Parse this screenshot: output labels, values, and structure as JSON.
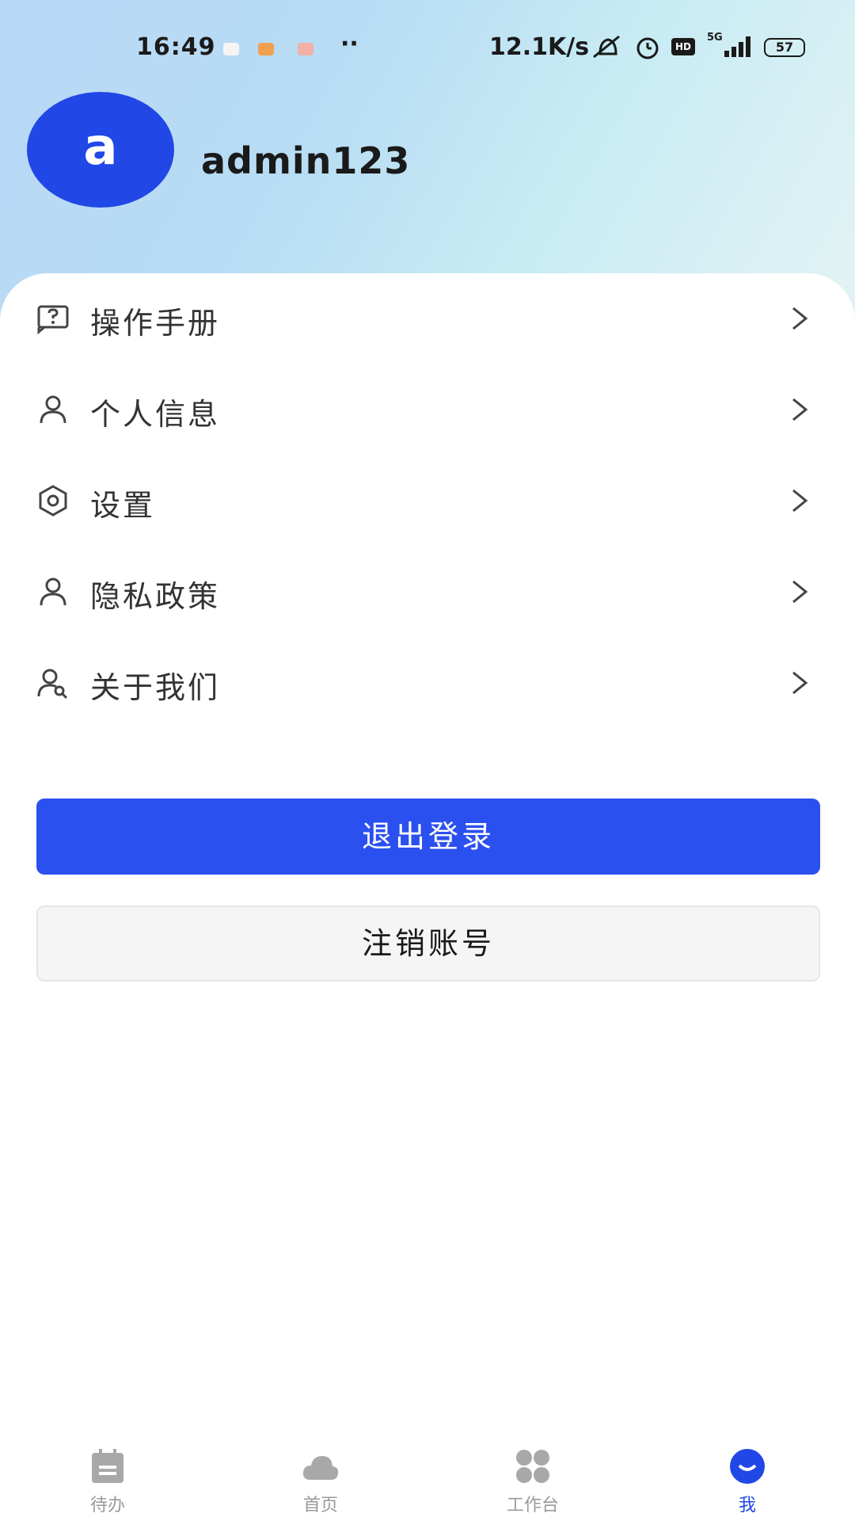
{
  "status_bar": {
    "time": "16:49",
    "dots": "··",
    "network_speed": "12.1K/s",
    "hd_label": "HD",
    "network_type": "5G",
    "battery": "57"
  },
  "profile": {
    "avatar_letter": "a",
    "username": "admin123"
  },
  "menu": {
    "items": [
      {
        "label": "操作手册",
        "icon": "question-book-icon"
      },
      {
        "label": "个人信息",
        "icon": "person-icon"
      },
      {
        "label": "设置",
        "icon": "hexagon-gear-icon"
      },
      {
        "label": "隐私政策",
        "icon": "person-icon"
      },
      {
        "label": "关于我们",
        "icon": "person-search-icon"
      }
    ]
  },
  "actions": {
    "logout_label": "退出登录",
    "deactivate_label": "注销账号"
  },
  "tab_bar": {
    "items": [
      {
        "label": "待办",
        "icon": "calendar-icon",
        "active": false
      },
      {
        "label": "首页",
        "icon": "cloud-icon",
        "active": false
      },
      {
        "label": "工作台",
        "icon": "grid-icon",
        "active": false
      },
      {
        "label": "我",
        "icon": "user-icon",
        "active": true
      }
    ]
  },
  "colors": {
    "primary": "#2b50f0",
    "avatar_bg": "#2147e6",
    "header_gradient_start": "#b9d8f6",
    "header_gradient_end": "#e3f3f4",
    "tab_inactive": "#9a9a9a"
  }
}
